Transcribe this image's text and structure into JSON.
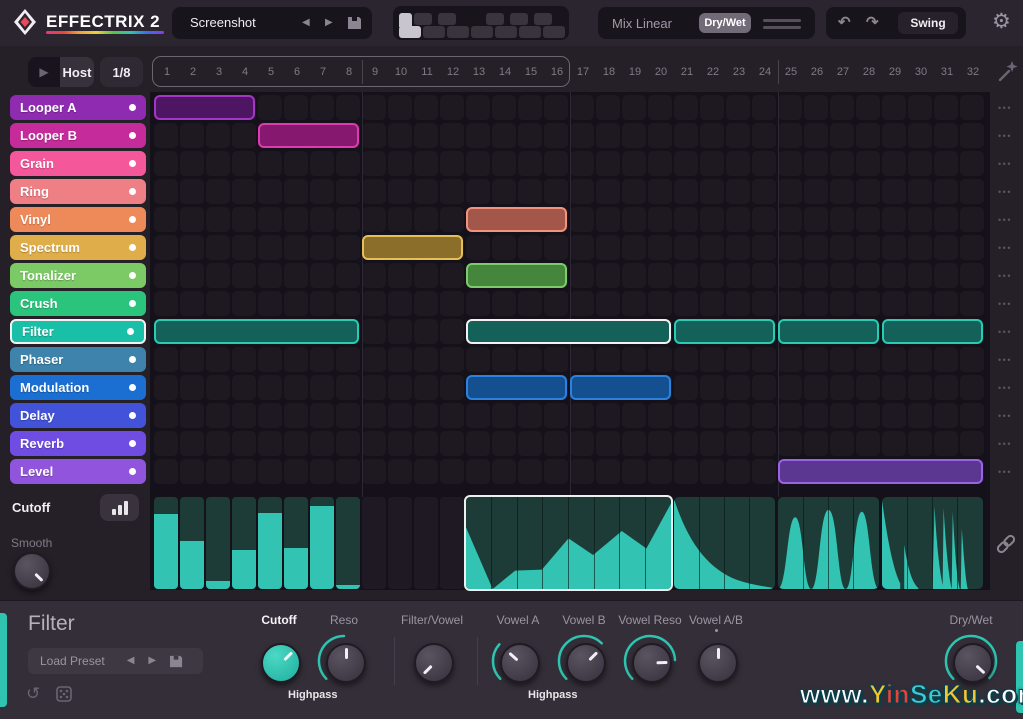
{
  "window": {
    "logo_text": "EFFECTRIX 2"
  },
  "topbar": {
    "preset_name": "Screenshot",
    "mix_label": "Mix Linear",
    "drywet_toggle": "Dry/Wet",
    "swing_label": "Swing",
    "pattern_count": 12,
    "selected_pattern": 1
  },
  "transport": {
    "host_label": "Host",
    "rate_label": "1/8"
  },
  "steps": {
    "numbers": [
      1,
      2,
      3,
      4,
      5,
      6,
      7,
      8,
      9,
      10,
      11,
      12,
      13,
      14,
      15,
      16,
      17,
      18,
      19,
      20,
      21,
      22,
      23,
      24,
      25,
      26,
      27,
      28,
      29,
      30,
      31,
      32
    ],
    "loop_start": 1,
    "loop_end": 16
  },
  "effects": [
    {
      "label": "Looper A",
      "color": "#8e2bb0",
      "block_fill": "#4e1563",
      "block_border": "#a335c9"
    },
    {
      "label": "Looper B",
      "color": "#c52b9b",
      "block_fill": "#86196f",
      "block_border": "#db3cae"
    },
    {
      "label": "Grain",
      "color": "#f4589a",
      "block_fill": "#8f2558",
      "block_border": "#f4589a"
    },
    {
      "label": "Ring",
      "color": "#ee7f84",
      "block_fill": "#8f4a4d",
      "block_border": "#ee7f84"
    },
    {
      "label": "Vinyl",
      "color": "#ee8a5a",
      "block_fill": "#a3574a",
      "block_border": "#f2937b"
    },
    {
      "label": "Spectrum",
      "color": "#dfae4a",
      "block_fill": "#8a6e29",
      "block_border": "#e5c05a"
    },
    {
      "label": "Tonalizer",
      "color": "#7cca66",
      "block_fill": "#45853c",
      "block_border": "#7ecb6b"
    },
    {
      "label": "Crush",
      "color": "#2bc47d",
      "block_fill": "#15684a",
      "block_border": "#2bc47d"
    },
    {
      "label": "Filter",
      "color": "#19bfa6",
      "block_fill": "#136158",
      "block_border": "#2bcab2",
      "selected": true
    },
    {
      "label": "Phaser",
      "color": "#3d83ab",
      "block_fill": "#234d66",
      "block_border": "#3d83ab"
    },
    {
      "label": "Modulation",
      "color": "#1b6fd2",
      "block_fill": "#14508f",
      "block_border": "#2c82de"
    },
    {
      "label": "Delay",
      "color": "#4253d9",
      "block_fill": "#28338a",
      "block_border": "#4253d9"
    },
    {
      "label": "Reverb",
      "color": "#6f4ce2",
      "block_fill": "#44308f",
      "block_border": "#6f4ce2"
    },
    {
      "label": "Level",
      "color": "#9055dc",
      "block_fill": "#5b3791",
      "block_border": "#9a63e6"
    }
  ],
  "blocks": [
    {
      "effect": "Looper A",
      "start": 1,
      "length": 4
    },
    {
      "effect": "Looper B",
      "start": 5,
      "length": 4
    },
    {
      "effect": "Vinyl",
      "start": 13,
      "length": 4
    },
    {
      "effect": "Spectrum",
      "start": 9,
      "length": 4
    },
    {
      "effect": "Tonalizer",
      "start": 13,
      "length": 4
    },
    {
      "effect": "Filter",
      "start": 1,
      "length": 8
    },
    {
      "effect": "Filter",
      "start": 13,
      "length": 8,
      "selected": true
    },
    {
      "effect": "Filter",
      "start": 21,
      "length": 4
    },
    {
      "effect": "Filter",
      "start": 25,
      "length": 4
    },
    {
      "effect": "Filter",
      "start": 29,
      "length": 4
    },
    {
      "effect": "Modulation",
      "start": 13,
      "length": 4
    },
    {
      "effect": "Modulation",
      "start": 17,
      "length": 4
    },
    {
      "effect": "Level",
      "start": 25,
      "length": 8
    }
  ],
  "row_menu_glyph": "•••",
  "left_panel": {
    "param_label": "Cutoff",
    "smooth_label": "Smooth",
    "smooth_knob_angle": 135
  },
  "automation": {
    "parameter": "Cutoff",
    "bar_steps": [
      1,
      2,
      3,
      4,
      5,
      6,
      7,
      8
    ],
    "bar_values": [
      0.82,
      0.52,
      0.09,
      0.42,
      0.83,
      0.45,
      0.9,
      0.04
    ],
    "selected_region": {
      "start": 13,
      "end": 20,
      "points": [
        [
          0,
          0.67
        ],
        [
          0.13,
          0
        ],
        [
          0.24,
          0.2
        ],
        [
          0.37,
          0.21
        ],
        [
          0.5,
          0.55
        ],
        [
          0.62,
          0.37
        ],
        [
          0.76,
          0.63
        ],
        [
          0.88,
          0.44
        ],
        [
          1,
          0.93
        ]
      ]
    },
    "regions": [
      {
        "start": 21,
        "end": 24,
        "shape": "decay"
      },
      {
        "start": 25,
        "end": 28,
        "shape": "bumps"
      },
      {
        "start": 29,
        "end": 32,
        "shape": "spikes"
      }
    ]
  },
  "footer": {
    "title": "Filter",
    "load_preset_label": "Load Preset",
    "highpass_label": "Highpass",
    "knobs": [
      {
        "label": "Cutoff",
        "angle": 45,
        "teal_cap": true,
        "bold_label": true
      },
      {
        "label": "Reso",
        "angle": 0,
        "arc": true
      },
      {
        "label": "Filter/Vowel",
        "angle": -135
      },
      {
        "label": "Vowel A",
        "angle": -48,
        "arc": true
      },
      {
        "label": "Vowel B",
        "angle": 45,
        "arc": true
      },
      {
        "label": "Vowel Reso",
        "angle": 88,
        "arc": true
      },
      {
        "label": "Vowel A/B",
        "angle": 0,
        "dot": true
      },
      {
        "label": "Dry/Wet",
        "angle": 133,
        "arc": true
      }
    ]
  },
  "watermark": {
    "segments": [
      {
        "text": "www.",
        "color": "#ffffff"
      },
      {
        "text": "Y",
        "color": "#f5c531"
      },
      {
        "text": "in",
        "color": "#e8413a"
      },
      {
        "text": "Se",
        "color": "#3fc9d3"
      },
      {
        "text": "Ku",
        "color": "#f5c531"
      },
      {
        "text": ".com",
        "color": "#ffffff"
      }
    ]
  },
  "colors": {
    "accent_teal": "#2ec4b0",
    "lane_fill": "#32c3b2",
    "lane_bg": "#1d3c38"
  }
}
